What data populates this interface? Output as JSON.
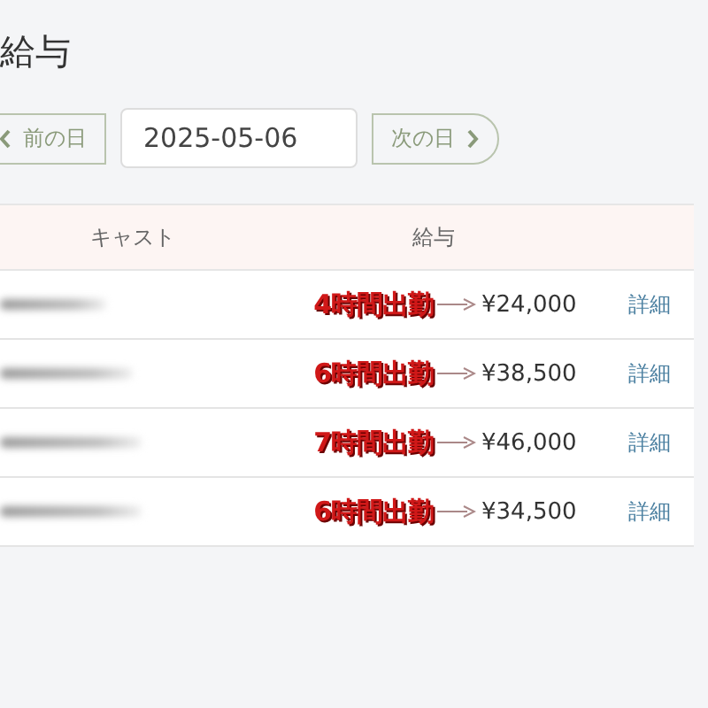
{
  "title": "給与",
  "nav": {
    "prev": {
      "label": "前の日"
    },
    "date": {
      "value": "2025-05-06"
    },
    "next": {
      "label": "次の日"
    }
  },
  "table": {
    "columns": [
      "キャスト",
      "給与"
    ],
    "rows": [
      {
        "annotation": "4時間出勤",
        "salary": "¥24,000",
        "action": "詳細"
      },
      {
        "annotation": "6時間出勤",
        "salary": "¥38,500",
        "action": "詳細"
      },
      {
        "annotation": "7時間出勤",
        "salary": "¥46,000",
        "action": "詳細"
      },
      {
        "annotation": "6時間出勤",
        "salary": "¥34,500",
        "action": "詳細"
      }
    ]
  }
}
